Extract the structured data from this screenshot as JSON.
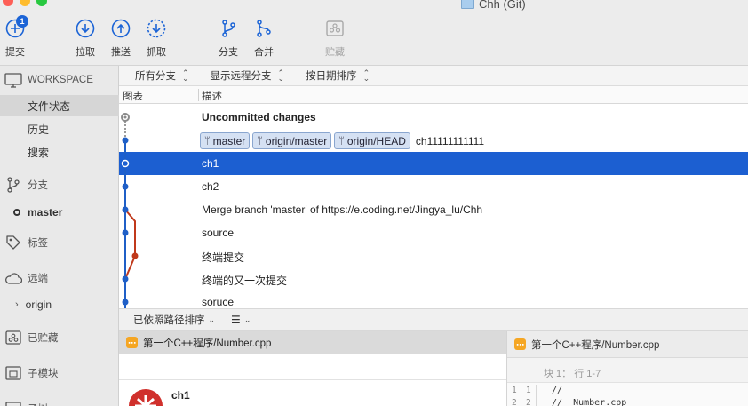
{
  "window": {
    "title": "Chh (Git)"
  },
  "toolbar": {
    "commit": {
      "label": "提交",
      "badge": "1"
    },
    "pull": {
      "label": "拉取"
    },
    "push": {
      "label": "推送"
    },
    "fetch": {
      "label": "抓取"
    },
    "branch": {
      "label": "分支"
    },
    "merge": {
      "label": "合并"
    },
    "stash": {
      "label": "贮藏"
    }
  },
  "sidebar": {
    "workspace": {
      "label": "WORKSPACE"
    },
    "workspace_items": [
      "文件状态",
      "历史",
      "搜索"
    ],
    "branches": {
      "label": "分支",
      "current": "master"
    },
    "tags": {
      "label": "标签"
    },
    "remotes": {
      "label": "远端",
      "origin": "origin"
    },
    "stashes": {
      "label": "已贮藏"
    },
    "submodules": {
      "label": "子模块"
    },
    "subtree": {
      "label": "子树"
    }
  },
  "filters": {
    "branches": "所有分支",
    "remote": "显示远程分支",
    "sort": "按日期排序"
  },
  "columns": {
    "graph": "图表",
    "description": "描述"
  },
  "commits": {
    "uncommitted": "Uncommitted changes",
    "tag_master": "master",
    "tag_origin_master": "origin/master",
    "tag_origin_head": "origin/HEAD",
    "head_message": "ch11111111111",
    "c1": "ch1",
    "c2": "ch2",
    "c3": "Merge branch 'master' of https://e.coding.net/Jingya_lu/Chh",
    "c4": "source",
    "c5": "终端提交",
    "c6": "终端的又一次提交",
    "c7": "soruce"
  },
  "bottom": {
    "sort": "已依照路径排序",
    "view_icon": "list-icon"
  },
  "files": {
    "item": "第一个C++程序/Number.cpp",
    "author": "ch1"
  },
  "diff": {
    "file": "第一个C++程序/Number.cpp",
    "hunk": "块 1： 行 1-7",
    "l1_old": "1",
    "l1_new": "1",
    "l1_src": "//",
    "l2_old": "2",
    "l2_new": "2",
    "l2_src": "//  Number.cpp"
  },
  "colors": {
    "selection": "#1c5fd1",
    "graph_blue": "#1f5fc7",
    "graph_red": "#c0391b",
    "badge": "#1c64d6"
  }
}
